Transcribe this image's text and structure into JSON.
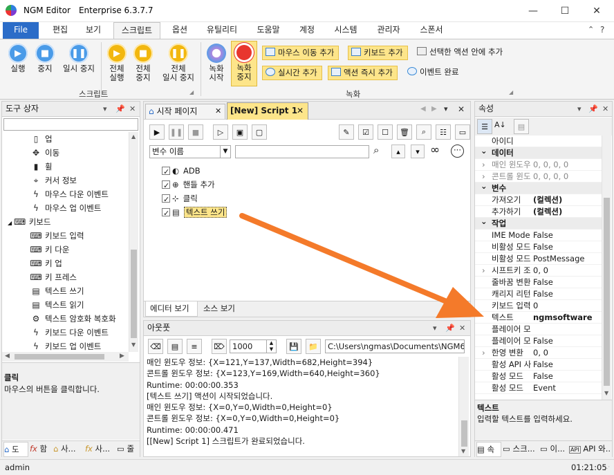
{
  "window": {
    "app_name": "NGM Editor",
    "edition": "Enterprise 6.3.7.7"
  },
  "ribbon_tabs": [
    "File",
    "편집",
    "보기",
    "스크립트",
    "옵션",
    "유틸리티",
    "도움말",
    "계정",
    "시스템",
    "관리자",
    "스폰서"
  ],
  "ribbon": {
    "script_group": {
      "label": "스크립트",
      "run": [
        "실행"
      ],
      "stop": [
        "중지"
      ],
      "pause": [
        "일시 중지"
      ],
      "run_all": [
        "전체",
        "실행"
      ],
      "stop_all": [
        "전체",
        "중지"
      ],
      "pause_all": [
        "전체",
        "일시 중지"
      ]
    },
    "record_group": {
      "label": "녹화",
      "record_start": [
        "녹화",
        "시작"
      ],
      "record_stop": [
        "녹화",
        "중지"
      ],
      "mouse_move": "마우스 이동 추가",
      "keyboard": "키보드 추가",
      "inside_action": "선택한 액션 안에 추가",
      "realtime": "실시간 추가",
      "action_now": "액션 즉시 추가",
      "event_done": "이벤트 완료"
    }
  },
  "toolbox": {
    "title": "도구 상자",
    "items": [
      {
        "icon": "mouse-icon",
        "glyph": "▯",
        "label": "업"
      },
      {
        "icon": "move-icon",
        "glyph": "✥",
        "label": "이동"
      },
      {
        "icon": "wheel-icon",
        "glyph": "▮",
        "label": "휠"
      },
      {
        "icon": "cursor-info-icon",
        "glyph": "⌖",
        "label": "커서 정보"
      },
      {
        "icon": "lightning-icon",
        "glyph": "ϟ",
        "label": "마우스 다운 이벤트"
      },
      {
        "icon": "lightning-icon",
        "glyph": "ϟ",
        "label": "마우스 업 이벤트"
      },
      {
        "icon": "keyboard-icon",
        "glyph": "⌨",
        "label": "키보드",
        "group": true
      },
      {
        "icon": "keyboard-icon",
        "glyph": "⌨",
        "label": "키보드 입력"
      },
      {
        "icon": "keyboard-icon",
        "glyph": "⌨",
        "label": "키 다운"
      },
      {
        "icon": "keyboard-icon",
        "glyph": "⌨",
        "label": "키 업"
      },
      {
        "icon": "keyboard-icon",
        "glyph": "⌨",
        "label": "키 프레스"
      },
      {
        "icon": "book-icon",
        "glyph": "▤",
        "label": "텍스트 쓰기"
      },
      {
        "icon": "book-icon",
        "glyph": "▤",
        "label": "텍스트 읽기"
      },
      {
        "icon": "encrypt-icon",
        "glyph": "⚙",
        "label": "텍스트 암호화 복호화"
      },
      {
        "icon": "lightning-icon",
        "glyph": "ϟ",
        "label": "키보드 다운 이벤트"
      },
      {
        "icon": "lightning-icon",
        "glyph": "ϟ",
        "label": "키보드 업 이벤트"
      }
    ],
    "desc_title": "클릭",
    "desc_text": "마우스의 버튼을 클릭합니다.",
    "bottom_tabs": [
      "도",
      "함",
      "사...",
      "사...",
      "줄"
    ]
  },
  "editor": {
    "tabs": [
      "시작 페이지",
      "[New] Script 1"
    ],
    "variable_select": "변수 이름",
    "search_value": "",
    "nodes": [
      "ADB",
      "핸들 추가",
      "클릭",
      "텍스트 쓰기"
    ],
    "bottom_tabs": [
      "에디터 보기",
      "소스 보기"
    ]
  },
  "output": {
    "title": "아웃풋",
    "count": "1000",
    "path": "C:\\Users\\ngmas\\Documents\\NGM6\\",
    "lines": [
      "매인 윈도우 정보: {X=121,Y=137,Width=682,Height=394}",
      "콘트롤 윈도우 정보: {X=123,Y=169,Width=640,Height=360}",
      "Runtime: 00:00:00.353",
      "[텍스트 쓰기] 액션이 시작되었습니다.",
      "매인 윈도우 정보: {X=0,Y=0,Width=0,Height=0}",
      "콘트롤 윈도우 정보: {X=0,Y=0,Width=0,Height=0}",
      "Runtime: 00:00:00.471",
      "[[New] Script 1] 스크립트가 완료되었습니다."
    ]
  },
  "properties": {
    "title": "속성",
    "rows": [
      {
        "name": "아이디",
        "value": ""
      },
      {
        "cat": "데이터"
      },
      {
        "name": "매인 윈도우",
        "value": "0, 0, 0, 0",
        "exp": true,
        "dim": true
      },
      {
        "name": "콘트롤 윈도",
        "value": "0, 0, 0, 0",
        "exp": true,
        "dim": true
      },
      {
        "cat": "변수"
      },
      {
        "name": "가져오기",
        "value": "(컬렉션)",
        "bold": true
      },
      {
        "name": "추가하기",
        "value": "(컬렉션)",
        "bold": true
      },
      {
        "cat": "작업"
      },
      {
        "name": "IME Mode",
        "value": "False"
      },
      {
        "name": "비활성 모드",
        "value": "False"
      },
      {
        "name": "비활성 모드",
        "value": "PostMessage"
      },
      {
        "name": "시프트키 조",
        "value": "0, 0",
        "exp": true
      },
      {
        "name": "줄바꿈 변환",
        "value": "False"
      },
      {
        "name": "캐리지 리턴",
        "value": "False"
      },
      {
        "name": "키보드 입력",
        "value": "0"
      },
      {
        "name": "텍스트",
        "value": "ngmsoftware",
        "bold": true
      },
      {
        "name": "플레이어 모",
        "value": ""
      },
      {
        "name": "플레이어 모",
        "value": "False"
      },
      {
        "name": "한영 변환",
        "value": "0, 0",
        "exp": true
      },
      {
        "name": "활성 API 사",
        "value": "False"
      },
      {
        "name": "활성 모드",
        "value": "False"
      },
      {
        "name": "활성 모드",
        "value": "Event"
      }
    ],
    "desc_title": "텍스트",
    "desc_text": "입력할 텍스트를 입력하세요.",
    "bottom_tabs": [
      "속",
      "스크...",
      "이...",
      "API 와..."
    ]
  },
  "statusbar": {
    "user": "admin",
    "time": "01:21:05"
  },
  "colors": {
    "accent": "#2b6cc8",
    "highlight": "#fde58a",
    "arrow": "#f47a2a"
  }
}
